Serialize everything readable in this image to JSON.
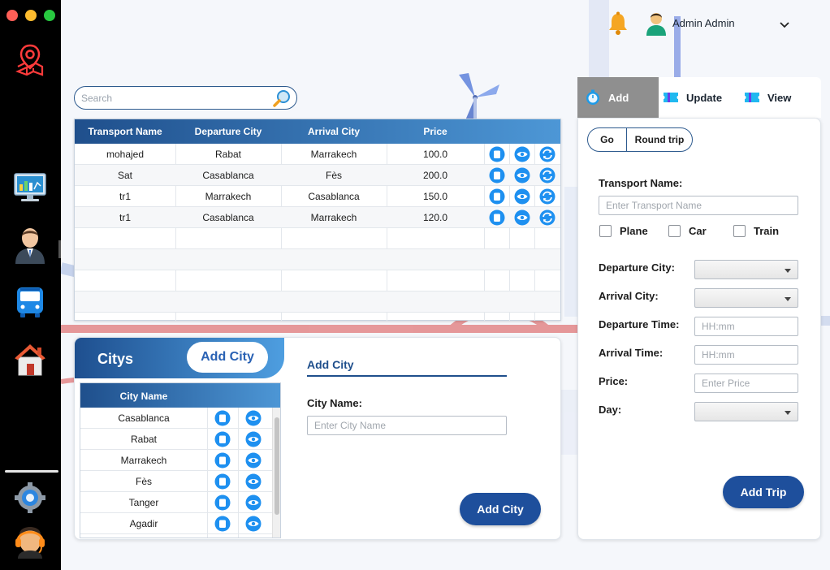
{
  "window": {
    "controls": [
      "close",
      "minimize",
      "maximize"
    ]
  },
  "sidebar": {
    "icons": [
      "map-location-icon",
      "dashboard-monitor-icon",
      "admin-user-icon",
      "bus-icon",
      "home-icon",
      "settings-gear-icon",
      "support-headset-icon"
    ]
  },
  "header": {
    "user_name": "Admin Admin"
  },
  "search": {
    "placeholder": "Search"
  },
  "transports_table": {
    "columns": [
      "Transport Name",
      "Departure City",
      "Arrival City",
      "Price"
    ],
    "rows": [
      {
        "name": "mohajed",
        "departure": "Rabat",
        "arrival": "Marrakech",
        "price": "100.0"
      },
      {
        "name": "Sat",
        "departure": "Casablanca",
        "arrival": "Fès",
        "price": "200.0"
      },
      {
        "name": "tr1",
        "departure": "Marrakech",
        "arrival": "Casablanca",
        "price": "150.0"
      },
      {
        "name": "tr1",
        "departure": "Casablanca",
        "arrival": "Marrakech",
        "price": "120.0"
      }
    ]
  },
  "citys_panel": {
    "title": "Citys",
    "tab_label": "Add City",
    "table_header": "City Name",
    "cities": [
      "Casablanca",
      "Rabat",
      "Marrakech",
      "Fès",
      "Tanger",
      "Agadir"
    ],
    "form": {
      "title": "Add City",
      "city_name_label": "City Name:",
      "city_name_placeholder": "Enter City Name",
      "submit_label": "Add City"
    }
  },
  "trip_panel": {
    "tabs": [
      "Add",
      "Update",
      "View"
    ],
    "active_tab": "Add",
    "segments": [
      "Go",
      "Round trip"
    ],
    "transport_name_label": "Transport Name:",
    "transport_name_placeholder": "Enter Transport Name",
    "types": [
      "Plane",
      "Car",
      "Train"
    ],
    "departure_city_label": "Departure City:",
    "arrival_city_label": "Arrival City:",
    "departure_time_label": "Departure Time:",
    "departure_time_placeholder": "HH:mm",
    "arrival_time_label": "Arrival Time:",
    "arrival_time_placeholder": "HH:mm",
    "price_label": "Price:",
    "price_placeholder": "Enter Price",
    "day_label": "Day:",
    "submit_label": "Add Trip"
  },
  "colors": {
    "header_gradient_start": "#1f4f8c",
    "header_gradient_end": "#4d97d6",
    "primary_button": "#1e4f9c",
    "action_icon": "#1e90f0",
    "active_tab": "#8f8f8f"
  }
}
